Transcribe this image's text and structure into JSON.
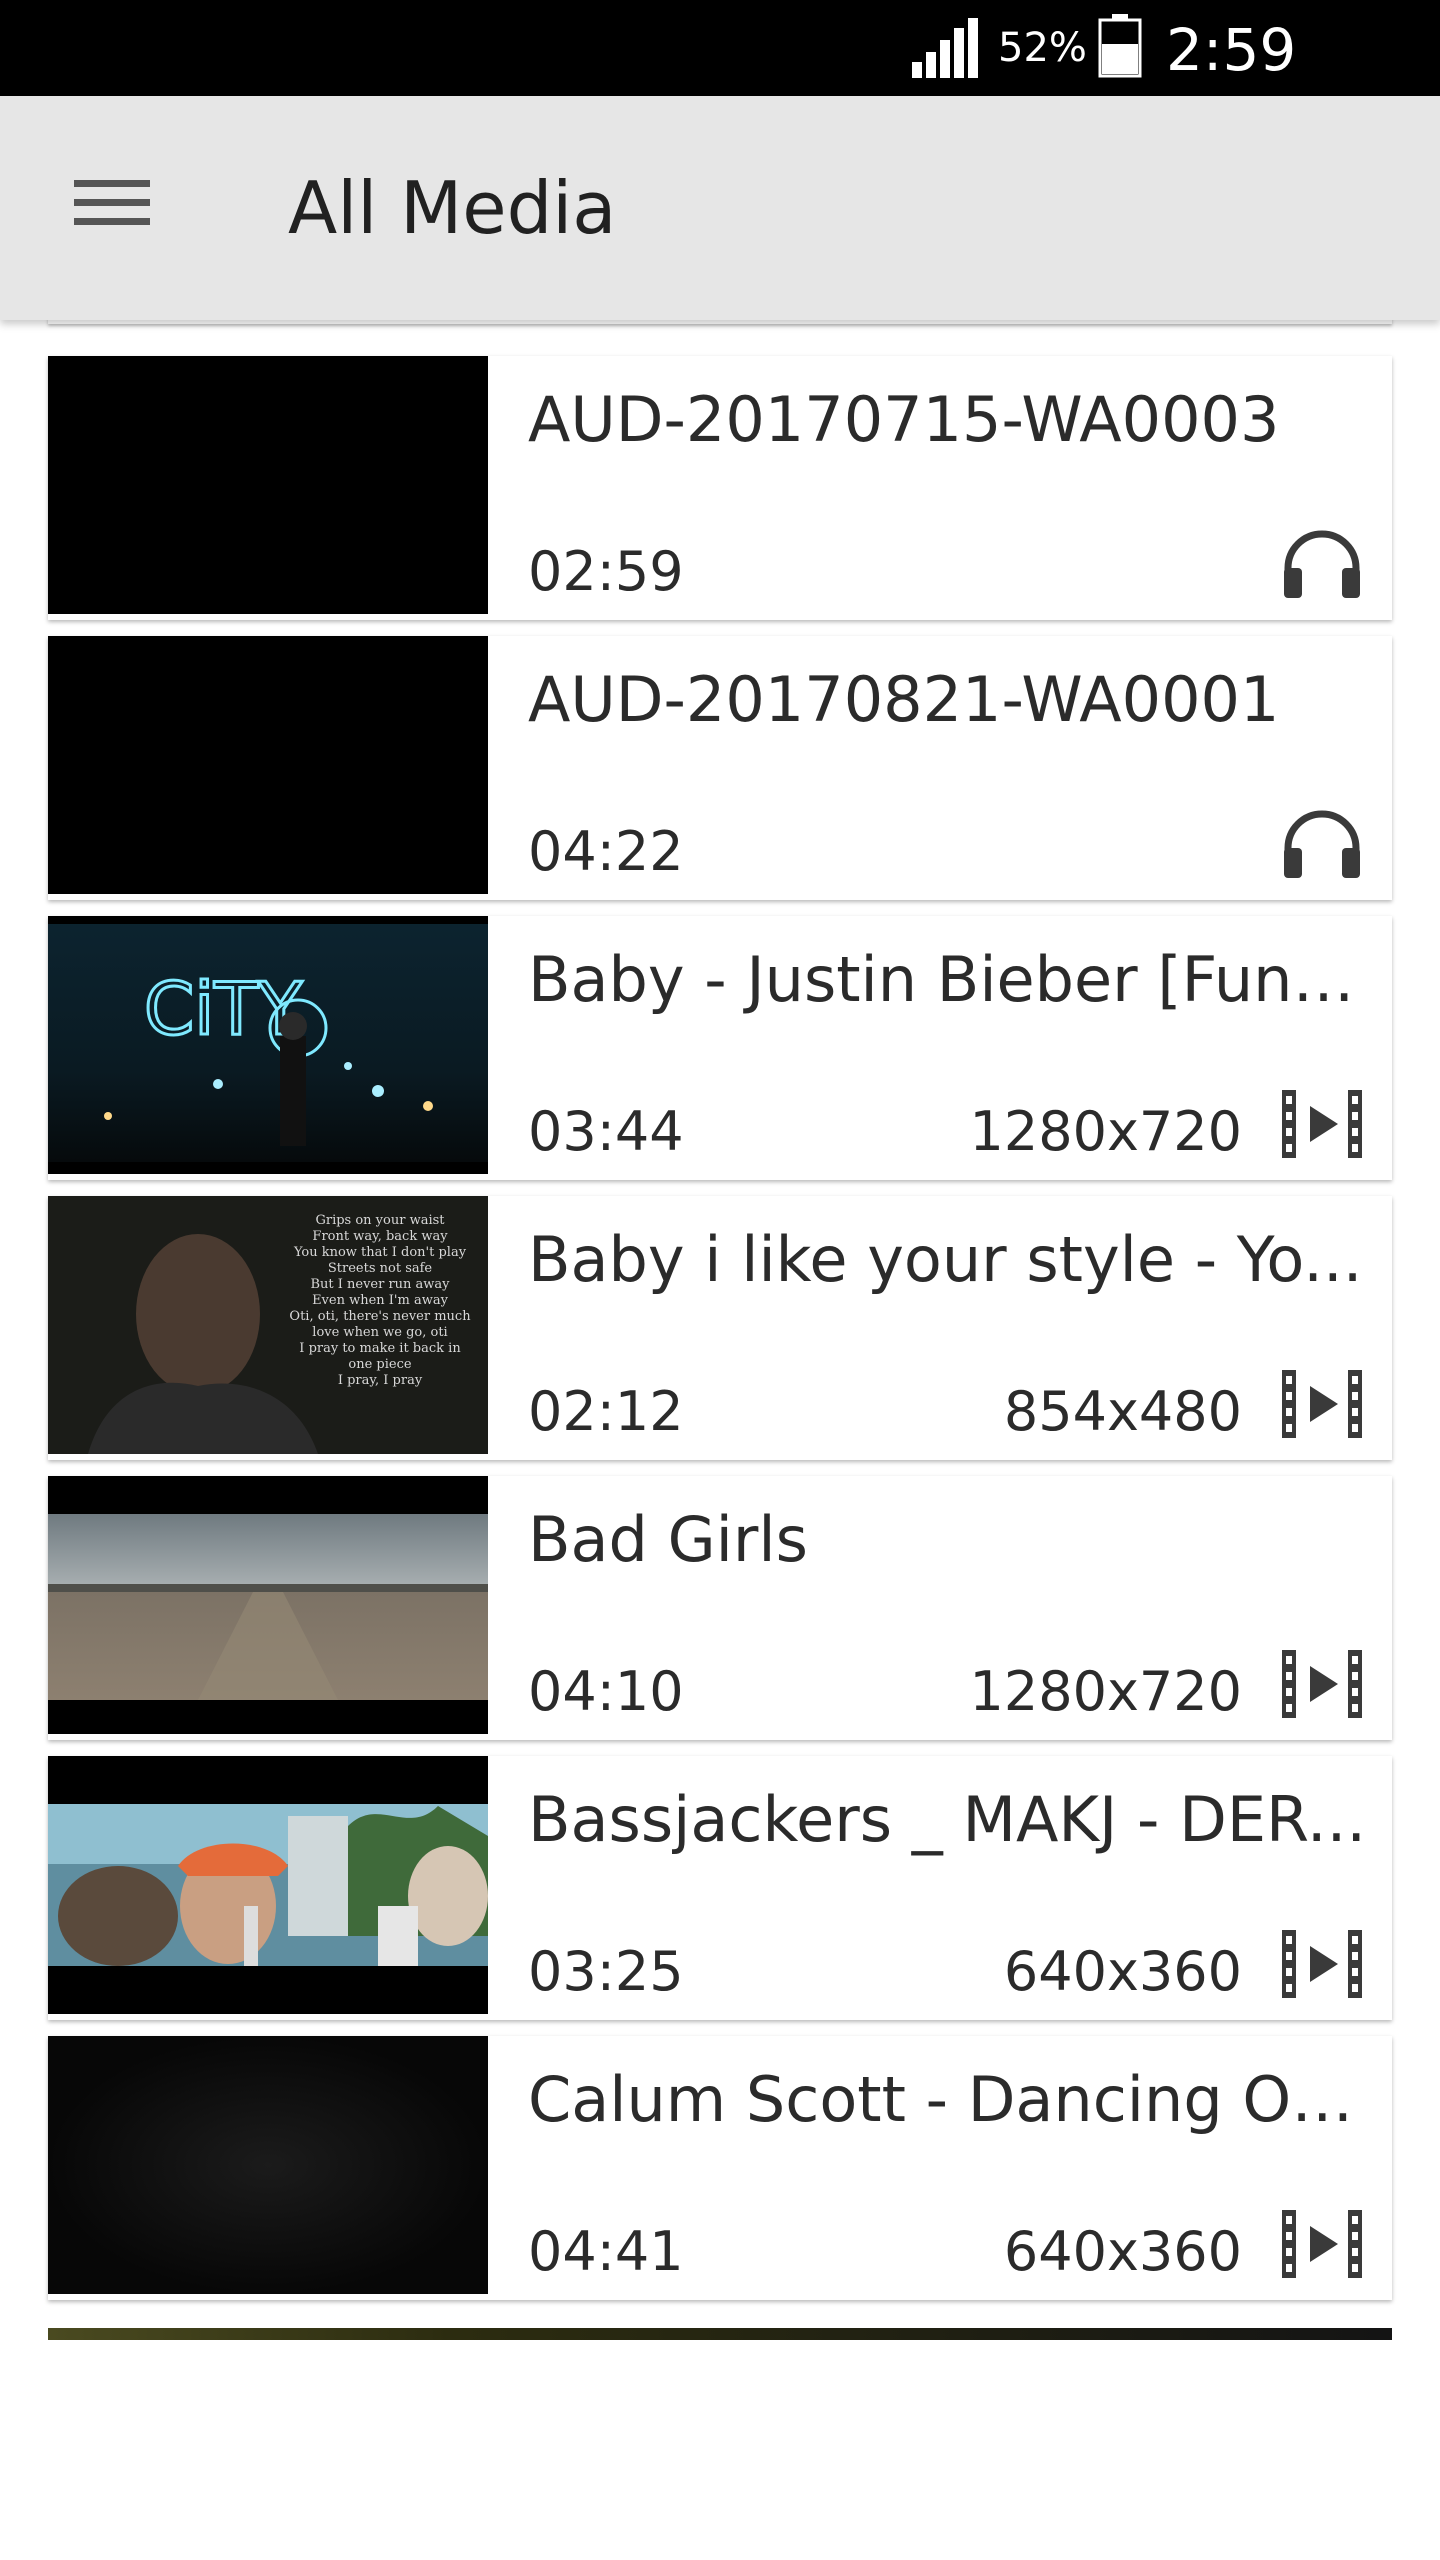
{
  "status_bar": {
    "battery_percent": "52%",
    "time": "2:59 a.m."
  },
  "app_bar": {
    "title": "All Media",
    "menu_icon": "hamburger-menu-icon"
  },
  "colors": {
    "app_bar_bg": "#e6e6e6",
    "status_bar_bg": "#000000",
    "text_primary": "#2b2b2b",
    "icon": "#3a3a3a"
  },
  "media_items": [
    {
      "name": "AUD-20170715-WA0003",
      "duration": "02:59",
      "resolution": "",
      "kind": "audio",
      "icon": "headphones-icon"
    },
    {
      "name": "AUD-20170821-WA0001",
      "duration": "04:22",
      "resolution": "",
      "kind": "audio",
      "icon": "headphones-icon"
    },
    {
      "name": "Baby - Justin Bieber [Funm...",
      "duration": "03:44",
      "resolution": "1280x720",
      "kind": "video",
      "icon": "film-icon"
    },
    {
      "name": "Baby i like your style - Yo...",
      "duration": "02:12",
      "resolution": "854x480",
      "kind": "video",
      "icon": "film-icon"
    },
    {
      "name": "Bad Girls",
      "duration": "04:10",
      "resolution": "1280x720",
      "kind": "video",
      "icon": "film-icon"
    },
    {
      "name": "Bassjackers _ MAKJ - DER...",
      "duration": "03:25",
      "resolution": "640x360",
      "kind": "video",
      "icon": "film-icon"
    },
    {
      "name": "Calum Scott - Dancing On ...",
      "duration": "04:41",
      "resolution": "640x360",
      "kind": "video",
      "icon": "film-icon"
    }
  ],
  "thumbnails": {
    "city_sign_text": "CiTY",
    "lyrics_lines": [
      "Grips on your waist",
      "Front way, back way",
      "You know that I don't play",
      "Streets not safe",
      "But I never run away",
      "Even when I'm away",
      "Oti, oti, there's never much",
      "love when we go, oti",
      "I pray to make it back in",
      "one piece",
      "I pray, I pray"
    ]
  }
}
